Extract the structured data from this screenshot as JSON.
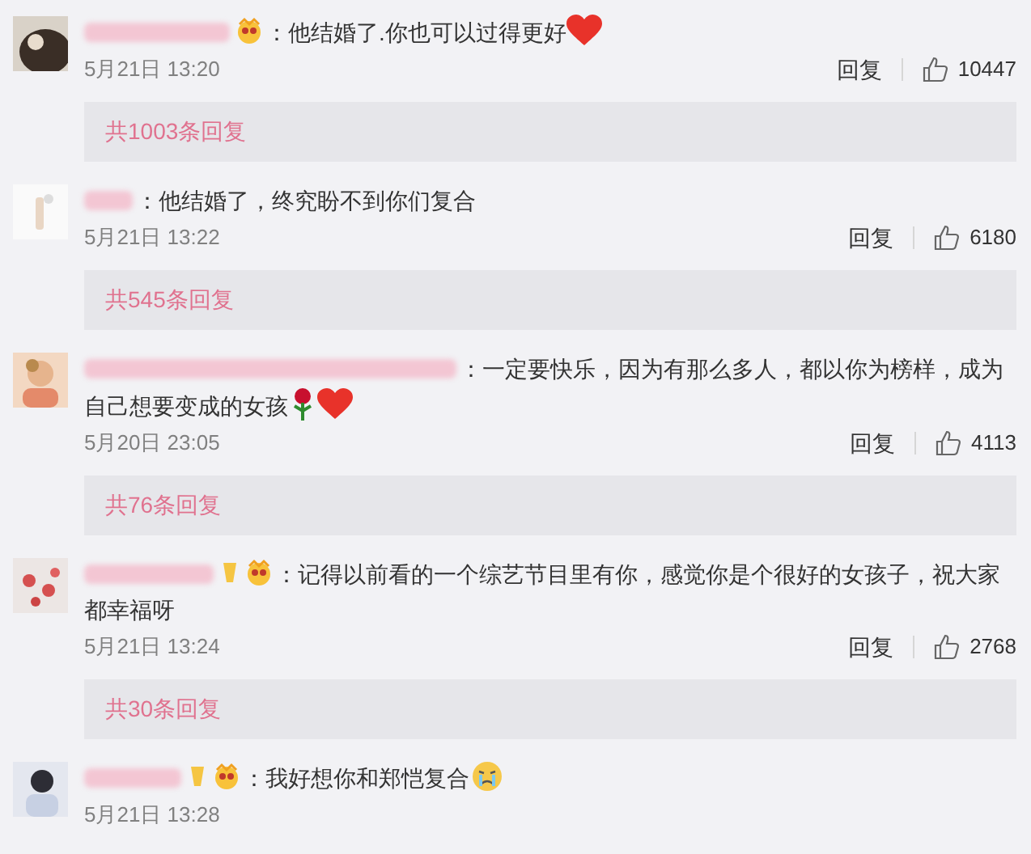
{
  "comments": [
    {
      "avatar": {
        "kind": "picture"
      },
      "badges": [
        {
          "kind": "crown"
        }
      ],
      "text": "：他结婚了.你也可以过得更好",
      "end_emoji": [
        {
          "kind": "heart"
        }
      ],
      "date": "5月21日 13:20",
      "reply": "回复",
      "likes": "10447",
      "replies": "共1003条回复"
    },
    {
      "avatar": {
        "kind": "picture"
      },
      "text": "：他结婚了，终究盼不到你们复合",
      "date": "5月21日 13:22",
      "reply": "回复",
      "likes": "6180",
      "replies": "共545条回复"
    },
    {
      "avatar": {
        "kind": "picture"
      },
      "text": "：一定要快乐，因为有那么多人，都以你为榜样，成为自己想要变成的女孩",
      "end_emoji": [
        {
          "kind": "rose"
        },
        {
          "kind": "heart"
        }
      ],
      "date": "5月20日 23:05",
      "reply": "回复",
      "likes": "4113",
      "replies": "共76条回复"
    },
    {
      "avatar": {
        "kind": "picture"
      },
      "badges": [
        {
          "kind": "thumb"
        },
        {
          "kind": "crown"
        }
      ],
      "text": "：记得以前看的一个综艺节目里有你，感觉你是个很好的女孩子，祝大家都幸福呀",
      "date": "5月21日 13:24",
      "reply": "回复",
      "likes": "2768",
      "replies": "共30条回复"
    },
    {
      "avatar": {
        "kind": "picture"
      },
      "badges": [
        {
          "kind": "thumb"
        },
        {
          "kind": "crown"
        }
      ],
      "text": "：我好想你和郑恺复合",
      "end_emoji": [
        {
          "kind": "crying"
        }
      ],
      "date": "5月21日 13:28"
    }
  ]
}
